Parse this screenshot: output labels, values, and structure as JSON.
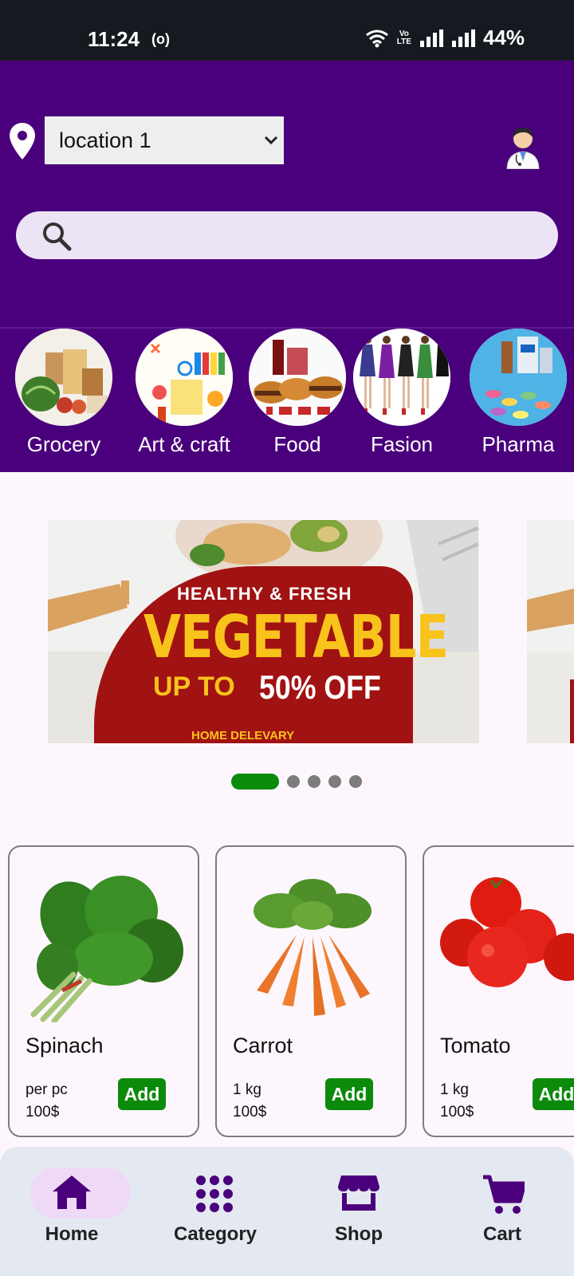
{
  "status_bar": {
    "time": "11:24",
    "hotspot": "(o)",
    "volte": [
      "Vo",
      "LTE"
    ],
    "battery": "44%"
  },
  "header": {
    "location": {
      "selected": "location 1"
    },
    "search": {
      "placeholder": ""
    }
  },
  "categories": [
    {
      "label": "Grocery",
      "icon": "grocery-icon"
    },
    {
      "label": "Art & craft",
      "icon": "art-icon"
    },
    {
      "label": "Food",
      "icon": "food-icon"
    },
    {
      "label": "Fasion",
      "icon": "fashion-icon"
    },
    {
      "label": "Pharma",
      "icon": "pharma-icon"
    }
  ],
  "banner": {
    "line1": "HEALTHY & FRESH",
    "line2": "VEGETABLE",
    "line3a": "UP TO",
    "line3b": "50% OFF",
    "line4": "HOME DELEVARY"
  },
  "carousel": {
    "slides": 5,
    "active": 0
  },
  "products": [
    {
      "name": "Spinach",
      "unit": "per pc",
      "price": "100$",
      "add_label": "Add"
    },
    {
      "name": "Carrot",
      "unit": "1 kg",
      "price": "100$",
      "add_label": "Add"
    },
    {
      "name": "Tomato",
      "unit": "1 kg",
      "price": "100$",
      "add_label": "Add"
    }
  ],
  "nav": [
    {
      "label": "Home",
      "icon": "home-icon",
      "active": true
    },
    {
      "label": "Category",
      "icon": "grid-icon",
      "active": false
    },
    {
      "label": "Shop",
      "icon": "shop-icon",
      "active": false
    },
    {
      "label": "Cart",
      "icon": "cart-icon",
      "active": false
    }
  ],
  "colors": {
    "primary": "#4a007c",
    "accent_green": "#0c8a0c",
    "nav_active_bg": "#eed9f7"
  }
}
